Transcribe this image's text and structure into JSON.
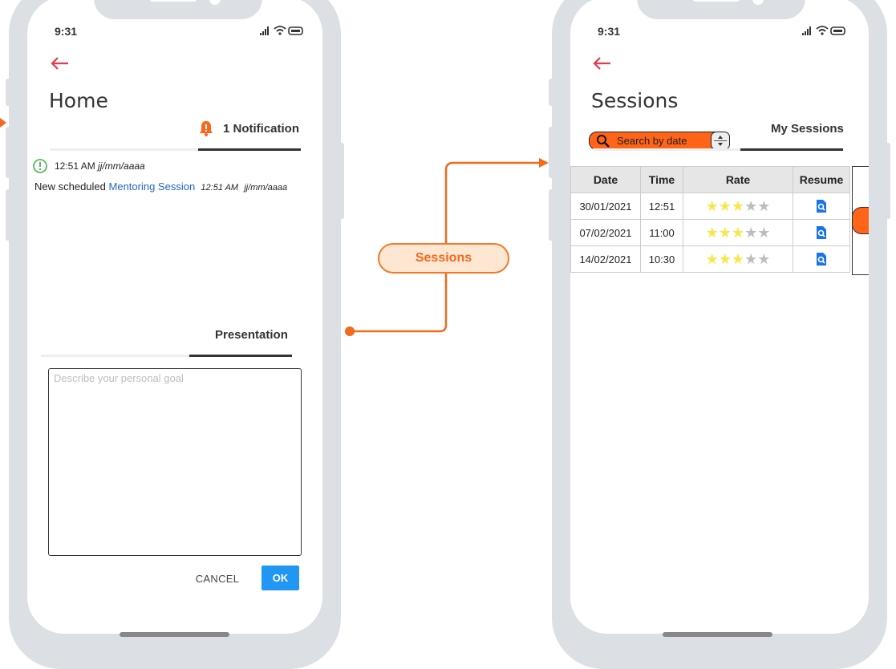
{
  "home": {
    "time": "9:31",
    "title": "Home",
    "notification_tab": "1 Notification",
    "notification": {
      "time": "12:51 AM",
      "date": "jj/mm/aaaa",
      "text": "New scheduled",
      "link": "Mentoring Session",
      "msg_time": "12:51 AM",
      "msg_date": "jj/mm/aaaa"
    },
    "presentation_tab": "Presentation",
    "goal_placeholder": "Describe your personal goal",
    "cancel_label": "CANCEL",
    "ok_label": "OK"
  },
  "flow": {
    "label": "Sessions",
    "color": "#f26a1b"
  },
  "sessions": {
    "time": "9:31",
    "title": "Sessions",
    "search_placeholder": "Search by date",
    "my_sessions_tab": "My Sessions",
    "columns": [
      "Date",
      "Time",
      "Rate",
      "Resume"
    ],
    "rows": [
      {
        "date": "30/01/2021",
        "time": "12:51",
        "rating": 3,
        "max": 5
      },
      {
        "date": "07/02/2021",
        "time": "11:00",
        "rating": 3,
        "max": 5
      },
      {
        "date": "14/02/2021",
        "time": "10:30",
        "rating": 3,
        "max": 5
      }
    ]
  },
  "colors": {
    "accent": "#ff6418",
    "back_arrow": "#e8394f",
    "ok_button": "#2196f3",
    "link": "#2566c9",
    "star_on": "#f5e84a",
    "star_off": "#bdbdbd"
  }
}
